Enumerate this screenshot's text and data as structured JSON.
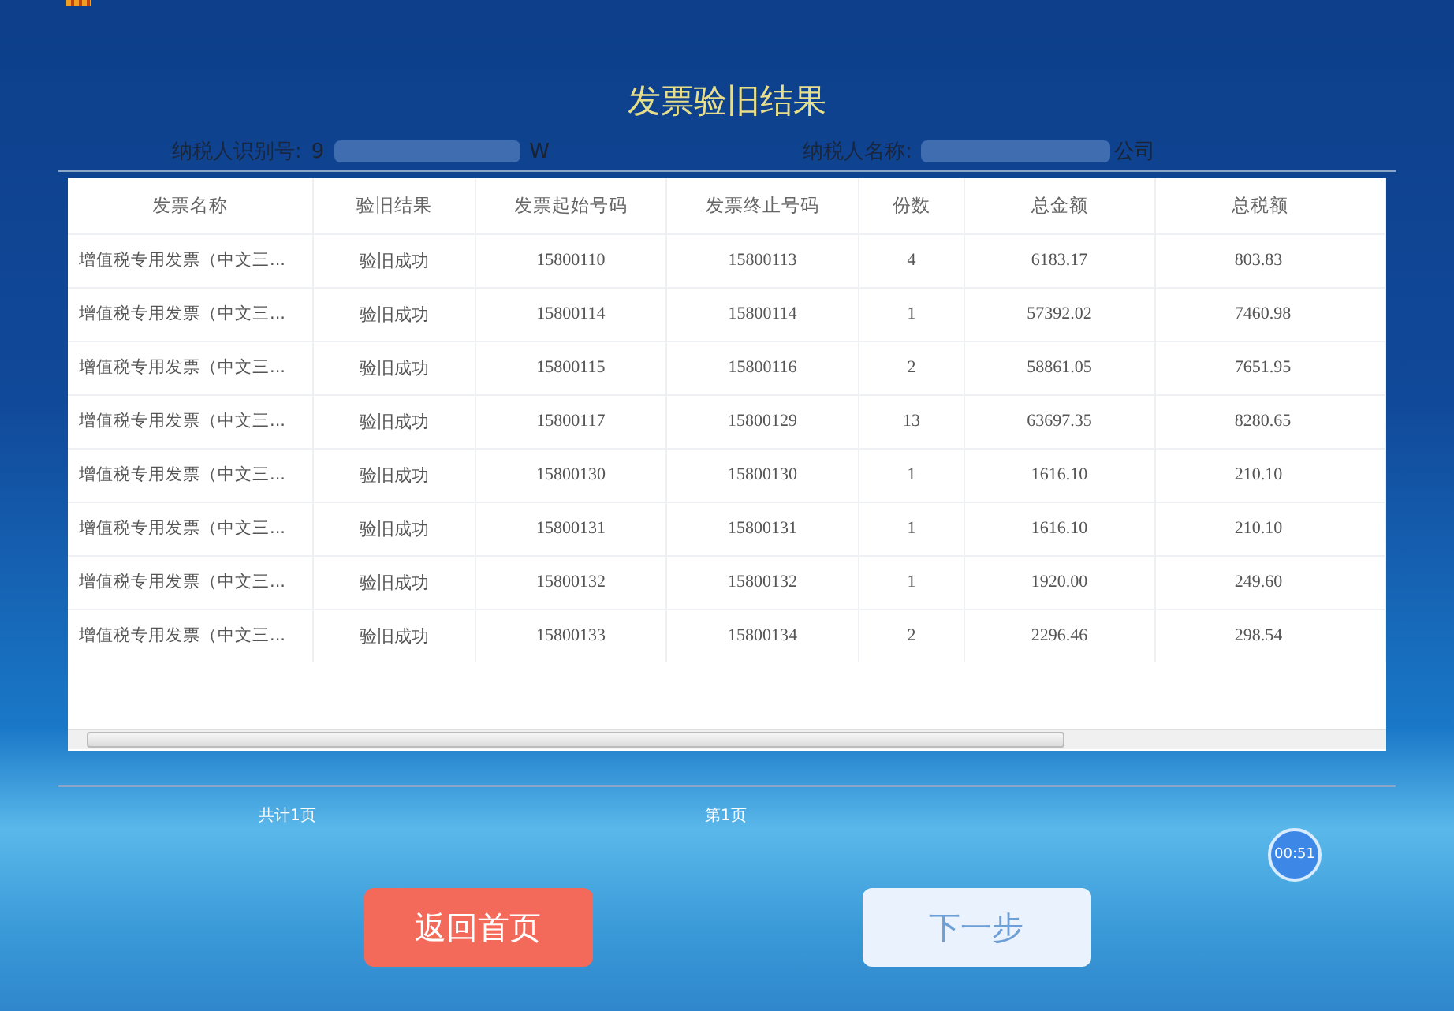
{
  "title": "发票验旧结果",
  "taxpayer": {
    "id_label": "纳税人识别号:",
    "id_prefix": "9",
    "id_suffix": "W",
    "name_label": "纳税人名称:",
    "name_suffix": "公司"
  },
  "table": {
    "columns": [
      "发票名称",
      "验旧结果",
      "发票起始号码",
      "发票终止号码",
      "份数",
      "总金额",
      "总税额"
    ],
    "rows": [
      [
        "增值税专用发票（中文三...",
        "验旧成功",
        "15800110",
        "15800113",
        "4",
        "6183.17",
        "803.83"
      ],
      [
        "增值税专用发票（中文三...",
        "验旧成功",
        "15800114",
        "15800114",
        "1",
        "57392.02",
        "7460.98"
      ],
      [
        "增值税专用发票（中文三...",
        "验旧成功",
        "15800115",
        "15800116",
        "2",
        "58861.05",
        "7651.95"
      ],
      [
        "增值税专用发票（中文三...",
        "验旧成功",
        "15800117",
        "15800129",
        "13",
        "63697.35",
        "8280.65"
      ],
      [
        "增值税专用发票（中文三...",
        "验旧成功",
        "15800130",
        "15800130",
        "1",
        "1616.10",
        "210.10"
      ],
      [
        "增值税专用发票（中文三...",
        "验旧成功",
        "15800131",
        "15800131",
        "1",
        "1616.10",
        "210.10"
      ],
      [
        "增值税专用发票（中文三...",
        "验旧成功",
        "15800132",
        "15800132",
        "1",
        "1920.00",
        "249.60"
      ],
      [
        "增值税专用发票（中文三...",
        "验旧成功",
        "15800133",
        "15800134",
        "2",
        "2296.46",
        "298.54"
      ]
    ]
  },
  "pagination": {
    "total": "共计1页",
    "current": "第1页"
  },
  "timer": "00:51",
  "buttons": [
    {
      "label": "返回首页",
      "kind": "primary"
    },
    {
      "label": "下一步",
      "kind": "secondary"
    }
  ]
}
